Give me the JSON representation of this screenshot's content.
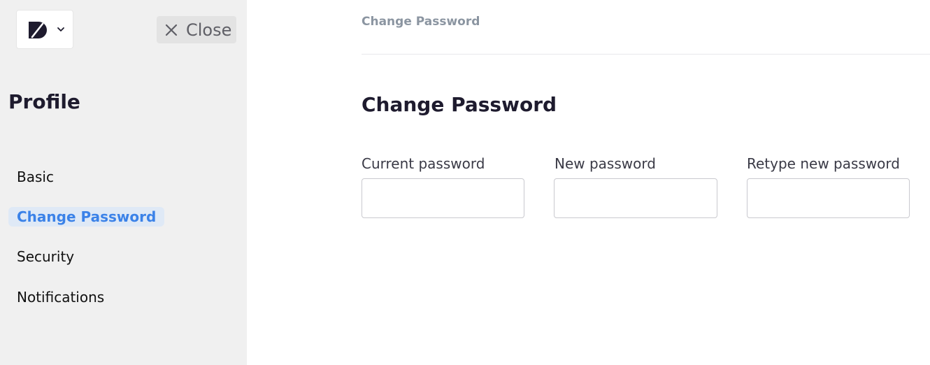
{
  "sidebar": {
    "logo_icon": "brand-logo-icon",
    "dropdown_icon": "chevron-down-icon",
    "close_icon": "close-icon",
    "close_label": "Close",
    "title": "Profile",
    "items": [
      {
        "label": "Basic",
        "active": false
      },
      {
        "label": "Change Password",
        "active": true
      },
      {
        "label": "Security",
        "active": false
      },
      {
        "label": "Notifications",
        "active": false
      }
    ]
  },
  "main": {
    "breadcrumb": "Change Password",
    "title": "Change Password",
    "fields": [
      {
        "label": "Current password",
        "value": ""
      },
      {
        "label": "New password",
        "value": ""
      },
      {
        "label": "Retype new password",
        "value": ""
      }
    ]
  },
  "colors": {
    "sidebar_bg": "#f0f0f0",
    "accent": "#3b82e8",
    "active_bg": "#dfe9f6",
    "breadcrumb": "#8b95a1",
    "text": "#1e1b2e"
  }
}
